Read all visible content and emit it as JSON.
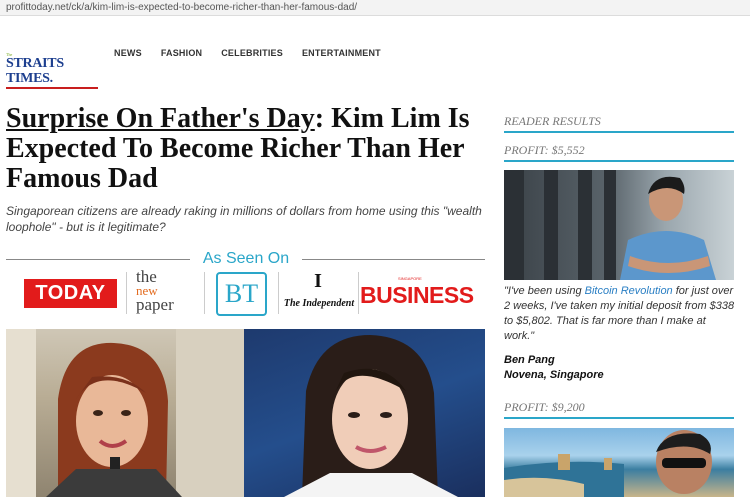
{
  "browser": {
    "url": "profittoday.net/ck/a/kim-lim-is-expected-to-become-richer-than-her-famous-dad/"
  },
  "site": {
    "logo_small": "The",
    "logo_main": "STRAITS TIMES."
  },
  "nav": [
    "NEWS",
    "FASHION",
    "CELEBRITIES",
    "ENTERTAINMENT"
  ],
  "article": {
    "headline_link": "Surprise On Father's Day",
    "headline_rest": ": Kim Lim Is Expected To Become Richer Than Her Famous Dad",
    "subheadline": "Singaporean citizens are already raking in millions of dollars from home using this \"wealth loophole\" - but is it legitimate?"
  },
  "as_seen_on": {
    "title": "As Seen On",
    "today": "TODAY",
    "newpaper_1": "the",
    "newpaper_2": "new",
    "newpaper_3": "paper",
    "bt": "BT",
    "independent_mark": "I",
    "independent": "The Independent",
    "business_small": "SINGAPORE",
    "business": "BUSINESS"
  },
  "sidebar": {
    "heading": "READER RESULTS",
    "profit_1": "PROFIT: $5,552",
    "quote_before": "\"I've been using ",
    "quote_link": "Bitcoin Revolution",
    "quote_after": " for just over 2 weeks, I've taken my initial deposit from $338 to $5,802. That is far more than I make at work.\"",
    "author_name": "Ben Pang",
    "author_location": "Novena, Singapore",
    "profit_2": "PROFIT: $9,200"
  },
  "colors": {
    "accent": "#2aa6c9",
    "brand_red": "#e21b1b",
    "logo_blue": "#1d3f8f",
    "link": "#2a7fc4"
  }
}
